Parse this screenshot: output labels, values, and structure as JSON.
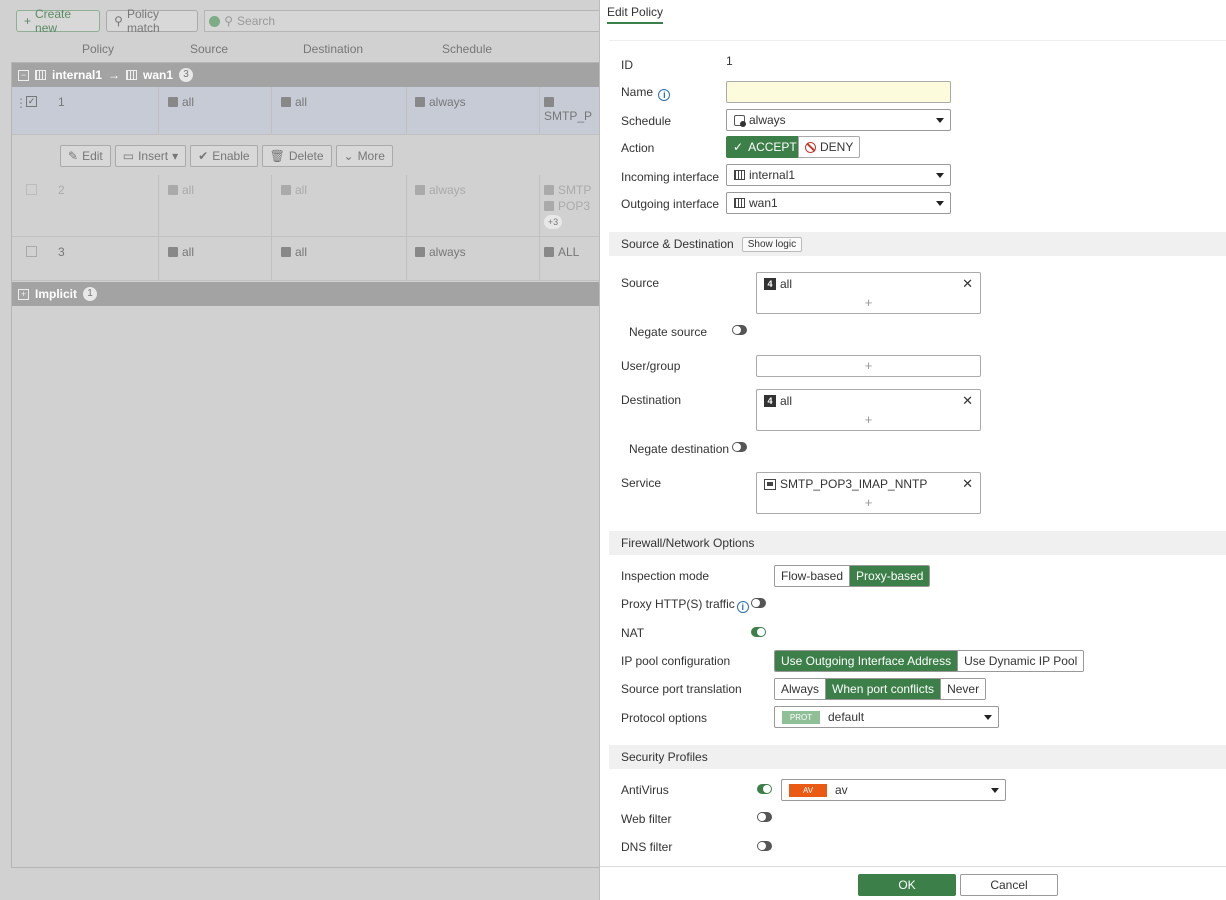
{
  "background": {
    "toolbar": {
      "create_new": "Create new",
      "policy_match": "Policy match",
      "search_placeholder": "Search"
    },
    "columns": [
      "Policy",
      "Source",
      "Destination",
      "Schedule"
    ],
    "group1": {
      "label_from": "internal1",
      "arrow": "→",
      "label_to": "wan1",
      "count": "3"
    },
    "rows": [
      {
        "id": "1",
        "source": "all",
        "destination": "all",
        "schedule": "always",
        "service": "SMTP_P"
      },
      {
        "id": "2",
        "source": "all",
        "destination": "all",
        "schedule": "always",
        "service1": "SMTP",
        "service2": "POP3",
        "more": "+3"
      },
      {
        "id": "3",
        "source": "all",
        "destination": "all",
        "schedule": "always",
        "service": "ALL"
      }
    ],
    "actions": [
      "Edit",
      "Insert",
      "Enable",
      "Delete",
      "More"
    ],
    "group2": {
      "label": "Implicit",
      "count": "1"
    }
  },
  "panel": {
    "tab": "Edit Policy",
    "id_label": "ID",
    "id_value": "1",
    "name_label": "Name",
    "name_value": "",
    "schedule_label": "Schedule",
    "schedule_value": "always",
    "action_label": "Action",
    "accept": "ACCEPT",
    "deny": "DENY",
    "incoming_label": "Incoming interface",
    "incoming_value": "internal1",
    "outgoing_label": "Outgoing interface",
    "outgoing_value": "wan1",
    "sec_srcdst": "Source & Destination",
    "show_logic": "Show logic",
    "source_label": "Source",
    "source_value": "all",
    "negate_source": "Negate source",
    "usergroup_label": "User/group",
    "destination_label": "Destination",
    "destination_value": "all",
    "negate_destination": "Negate destination",
    "service_label": "Service",
    "service_value": "SMTP_POP3_IMAP_NNTP",
    "sec_firewall": "Firewall/Network Options",
    "inspection_label": "Inspection mode",
    "inspection_options": [
      "Flow-based",
      "Proxy-based"
    ],
    "proxy_label": "Proxy HTTP(S) traffic",
    "nat_label": "NAT",
    "ippool_label": "IP pool configuration",
    "ippool_options": [
      "Use Outgoing Interface Address",
      "Use Dynamic IP Pool"
    ],
    "spt_label": "Source port translation",
    "spt_options": [
      "Always",
      "When port conflicts",
      "Never"
    ],
    "protocol_label": "Protocol options",
    "protocol_badge": "PROT",
    "protocol_value": "default",
    "sec_security": "Security Profiles",
    "antivirus_label": "AntiVirus",
    "av_badge": "AV",
    "av_value": "av",
    "webfilter_label": "Web filter",
    "dnsfilter_label": "DNS filter",
    "ok": "OK",
    "cancel": "Cancel"
  },
  "colors": {
    "accent": "#3c7f49",
    "av_badge": "#ea5a14",
    "prot_badge": "#8fbf96"
  }
}
